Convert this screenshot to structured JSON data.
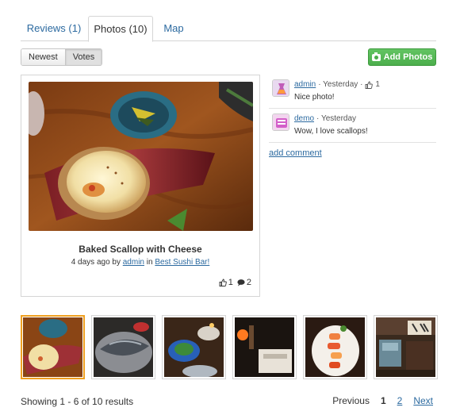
{
  "tabs": [
    {
      "label": "Reviews (1)"
    },
    {
      "label": "Photos (10)"
    },
    {
      "label": "Map"
    }
  ],
  "sort": {
    "newest": "Newest",
    "votes": "Votes"
  },
  "add_photos": {
    "label": "Add Photos",
    "icon": "camera-icon"
  },
  "photo": {
    "title": "Baked Scallop with Cheese",
    "meta_prefix": "4 days ago by",
    "author": "admin",
    "meta_in": "in",
    "place": "Best Sushi Bar!",
    "likes": "1",
    "comments": "2"
  },
  "comments": [
    {
      "user": "admin",
      "time": "· Yesterday ·",
      "likes": "1",
      "text": "Nice photo!"
    },
    {
      "user": "demo",
      "time": "· Yesterday",
      "likes": "",
      "text": "Wow, I love scallops!"
    }
  ],
  "add_comment": "add comment",
  "results": "Showing 1 - 6 of 10 results",
  "pager": {
    "previous": "Previous",
    "page1": "1",
    "page2": "2",
    "next": "Next"
  },
  "colors": {
    "link": "#2c6aa0",
    "button_green": "#4cae4c",
    "selected_border": "#f0a020"
  }
}
